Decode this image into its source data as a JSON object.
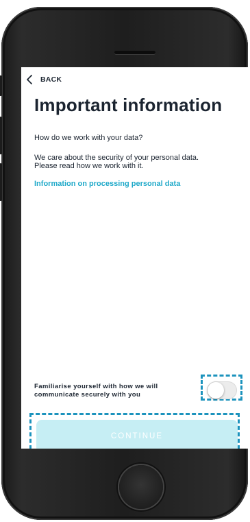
{
  "header": {
    "back_label": "BACK",
    "back_icon": "chevron-left-icon"
  },
  "main": {
    "title": "Important information",
    "question": "How do we work with your data?",
    "paragraph_lines": [
      "We care about the security of your personal data.",
      "Please read how we work with it."
    ],
    "link_text": "Information on processing personal data"
  },
  "footer": {
    "toggle_label_lines": [
      "Familiarise yourself with how we will",
      "communicate securely with you"
    ],
    "toggle_on": false,
    "continue_label": "CONTINUE"
  },
  "colors": {
    "text": "#1b2430",
    "link": "#1fa9c9",
    "button_disabled": "#c6eef4",
    "highlight": "#1c93bd"
  }
}
